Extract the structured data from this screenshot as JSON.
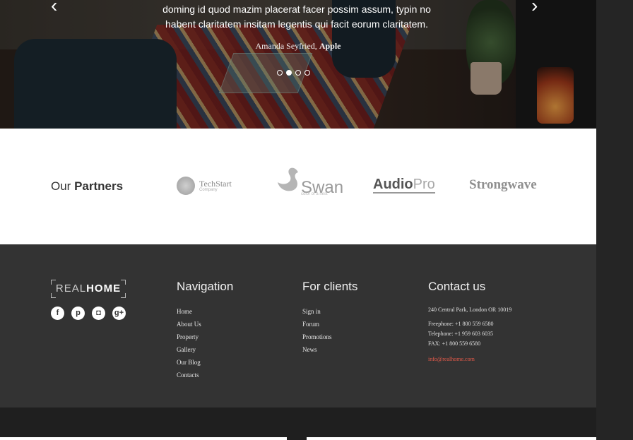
{
  "hero": {
    "quote_line1": "doming id quod mazim placerat facer possim assum, typin no",
    "quote_line2": "habent claritatem insitam legentis qui facit eorum claritatem.",
    "author_name": "Amanda Seyfried,",
    "author_company": "Apple",
    "prev_arrow": "‹",
    "next_arrow": "›",
    "slides": 4,
    "active_slide": 2
  },
  "partners": {
    "title_light": "Our",
    "title_bold": "Partners",
    "logos": [
      {
        "name": "TechStart",
        "sub": "Company"
      },
      {
        "name": "Swan",
        "sub": "color of a nest"
      },
      {
        "name_bold": "Audio",
        "name_light": "Pro"
      },
      {
        "name": "Strongwave"
      }
    ]
  },
  "footer": {
    "brand_light": "REAL",
    "brand_bold": "HOME",
    "social": [
      {
        "icon": "facebook-icon",
        "glyph": "f"
      },
      {
        "icon": "pinterest-icon",
        "glyph": "p"
      },
      {
        "icon": "instagram-icon",
        "glyph": "◘"
      },
      {
        "icon": "google-plus-icon",
        "glyph": "g+"
      }
    ],
    "navigation": {
      "title": "Navigation",
      "items": [
        "Home",
        "About Us",
        "Property",
        "Gallery",
        "Our Blog",
        "Contacts"
      ]
    },
    "clients": {
      "title": "For clients",
      "items": [
        "Sign in",
        "Forum",
        "Promotions",
        "News"
      ]
    },
    "contact": {
      "title": "Contact us",
      "address": "240 Central Park, London OR 10019",
      "freephone": "Freephone: +1 800 559 6580",
      "telephone": "Telephone: +1 959 603 6035",
      "fax": "FAX: +1 800 559 6580",
      "email": "info@realhome.com"
    }
  },
  "colors": {
    "accent_link": "#e45a4a",
    "footer_bg": "#333333",
    "partners_bg": "#ffffff"
  }
}
